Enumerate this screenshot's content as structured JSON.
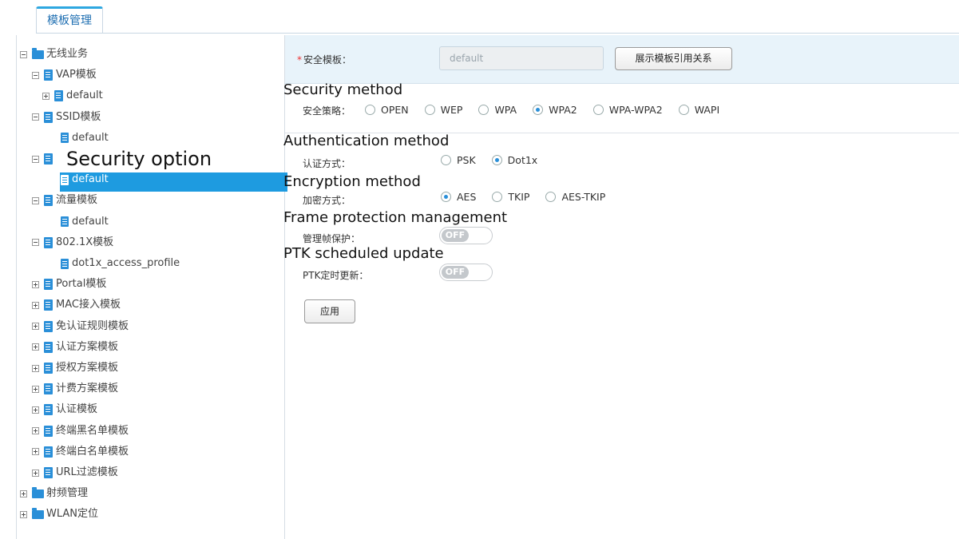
{
  "tab": {
    "label": "模板管理"
  },
  "tree": {
    "nodes": [
      {
        "label": "无线业务",
        "icon": "folder-icon",
        "toggle": "minus"
      },
      {
        "label": "VAP模板",
        "icon": "document-icon",
        "toggle": "minus"
      },
      {
        "label": "default",
        "icon": "document-icon",
        "toggle": "plus"
      },
      {
        "label": "SSID模板",
        "icon": "document-icon",
        "toggle": "minus"
      },
      {
        "label": "default",
        "icon": "document-icon"
      },
      {
        "label": "",
        "icon": "document-icon",
        "toggle": "minus"
      },
      {
        "label": "default",
        "icon": "document-icon",
        "selected": true
      },
      {
        "label": "流量模板",
        "icon": "document-icon",
        "toggle": "minus"
      },
      {
        "label": "default",
        "icon": "document-icon"
      },
      {
        "label": "802.1X模板",
        "icon": "document-icon",
        "toggle": "minus"
      },
      {
        "label": "dot1x_access_profile",
        "icon": "document-icon"
      },
      {
        "label": "Portal模板",
        "icon": "document-icon",
        "toggle": "plus"
      },
      {
        "label": "MAC接入模板",
        "icon": "document-icon",
        "toggle": "plus"
      },
      {
        "label": "免认证规则模板",
        "icon": "document-icon",
        "toggle": "plus"
      },
      {
        "label": "认证方案模板",
        "icon": "document-icon",
        "toggle": "plus"
      },
      {
        "label": "授权方案模板",
        "icon": "document-icon",
        "toggle": "plus"
      },
      {
        "label": "计费方案模板",
        "icon": "document-icon",
        "toggle": "plus"
      },
      {
        "label": "认证模板",
        "icon": "document-icon",
        "toggle": "plus"
      },
      {
        "label": "终端黑名单模板",
        "icon": "document-icon",
        "toggle": "plus"
      },
      {
        "label": "终端白名单模板",
        "icon": "document-icon",
        "toggle": "plus"
      },
      {
        "label": "URL过滤模板",
        "icon": "document-icon",
        "toggle": "plus"
      },
      {
        "label": "射频管理",
        "icon": "folder-icon",
        "toggle": "plus"
      },
      {
        "label": "WLAN定位",
        "icon": "folder-icon",
        "toggle": "plus"
      }
    ],
    "overlay_label": "Security option"
  },
  "form": {
    "security_template": {
      "required_mark": "*",
      "label": "安全模板：",
      "value": "default",
      "button": "展示模板引用关系"
    },
    "security_method": {
      "heading": "Security method",
      "label": "安全策略：",
      "options": [
        "OPEN",
        "WEP",
        "WPA",
        "WPA2",
        "WPA-WPA2",
        "WAPI"
      ],
      "selected": "WPA2"
    },
    "auth_method": {
      "heading": "Authentication method",
      "label": "认证方式：",
      "options": [
        "PSK",
        "Dot1x"
      ],
      "selected": "Dot1x"
    },
    "encryption_method": {
      "heading": "Encryption method",
      "label": "加密方式：",
      "options": [
        "AES",
        "TKIP",
        "AES-TKIP"
      ],
      "selected": "AES"
    },
    "frame_protection": {
      "heading": "Frame protection management",
      "label": "管理帧保护：",
      "state": "OFF"
    },
    "ptk_update": {
      "heading": "PTK scheduled update",
      "label": "PTK定时更新：",
      "state": "OFF"
    },
    "apply_label": "应用"
  }
}
